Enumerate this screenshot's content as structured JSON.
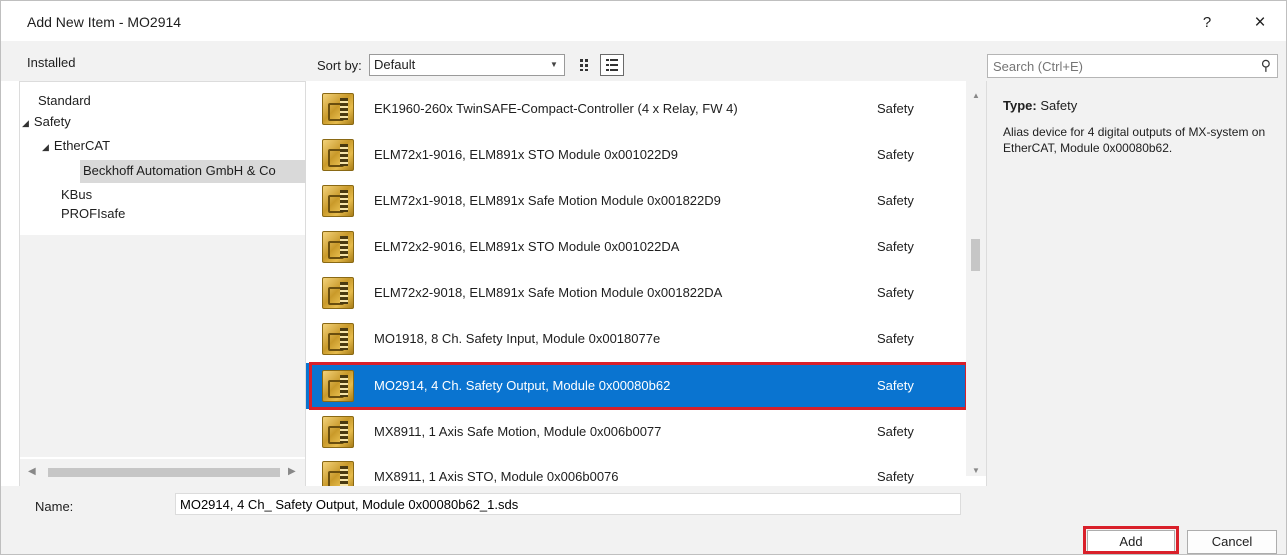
{
  "window": {
    "title": "Add New Item - MO2914",
    "help": "?",
    "close": "×"
  },
  "left": {
    "header": "Installed",
    "tree": [
      {
        "label": "Standard"
      },
      {
        "label": "Safety",
        "arrow": "◢"
      },
      {
        "label": "EtherCAT",
        "arrow": "◢"
      },
      {
        "label": "Beckhoff Automation GmbH & Co"
      },
      {
        "label": "KBus"
      },
      {
        "label": "PROFIsafe"
      }
    ]
  },
  "toolbar": {
    "sort_label": "Sort by:",
    "sort_value": "Default"
  },
  "search": {
    "placeholder": "Search (Ctrl+E)"
  },
  "items": [
    {
      "name": "EK1960-260x TwinSAFE-Compact-Controller (4 x Relay, FW 4)",
      "category": "Safety"
    },
    {
      "name": "ELM72x1-9016, ELM891x STO Module 0x001022D9",
      "category": "Safety"
    },
    {
      "name": "ELM72x1-9018, ELM891x Safe Motion Module 0x001822D9",
      "category": "Safety"
    },
    {
      "name": "ELM72x2-9016, ELM891x STO Module 0x001022DA",
      "category": "Safety"
    },
    {
      "name": "ELM72x2-9018, ELM891x Safe Motion Module 0x001822DA",
      "category": "Safety"
    },
    {
      "name": "MO1918, 8 Ch. Safety Input, Module 0x0018077e",
      "category": "Safety"
    },
    {
      "name": "MO2914, 4 Ch. Safety Output, Module 0x00080b62",
      "category": "Safety"
    },
    {
      "name": "MX8911, 1 Axis Safe Motion, Module 0x006b0077",
      "category": "Safety"
    },
    {
      "name": "MX8911, 1 Axis STO, Module 0x006b0076",
      "category": "Safety"
    }
  ],
  "details": {
    "type_label": "Type:",
    "type_value": "Safety",
    "description": "Alias device for 4 digital outputs of MX-system on EtherCAT, Module 0x00080b62."
  },
  "footer": {
    "name_label": "Name:",
    "name_value": "MO2914, 4 Ch_ Safety Output, Module 0x00080b62_1.sds",
    "add_label": "Add",
    "cancel_label": "Cancel"
  },
  "colors": {
    "selection": "#0a74d0",
    "highlight": "#d9202a"
  }
}
